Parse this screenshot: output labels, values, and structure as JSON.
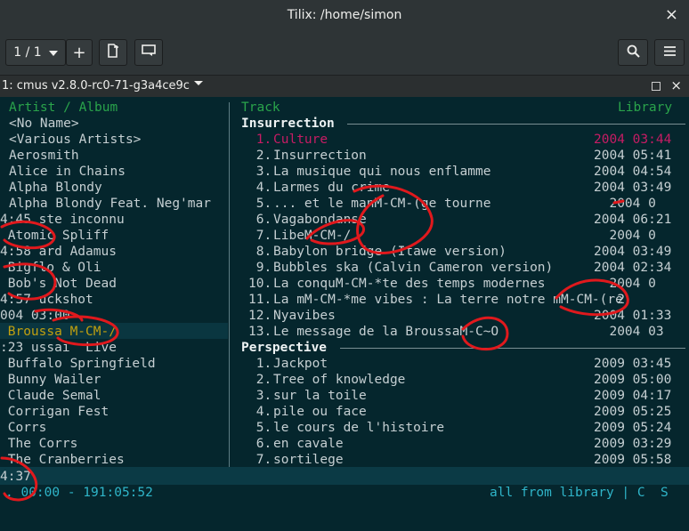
{
  "window": {
    "title": "Tilix: /home/simon",
    "close_glyph": "×"
  },
  "toolbar": {
    "session_count": "1 / 1",
    "add_label": "+",
    "icons": [
      "dropdown-icon",
      "plus-icon",
      "new-tab-icon",
      "sync-input-icon",
      "search-icon",
      "menu-icon"
    ]
  },
  "session": {
    "title": "1: cmus v2.8.0-rc0-71-g3a4ce9c"
  },
  "cmus": {
    "left_header": "Artist / Album",
    "track_header": "Track",
    "library_header": "Library",
    "artists": [
      {
        "text": "<No Name>"
      },
      {
        "text": "<Various Artists>"
      },
      {
        "text": "Aerosmith"
      },
      {
        "text": "Alice in Chains"
      },
      {
        "text": "Alpha Blondy"
      },
      {
        "text": "Alpha Blondy Feat. Neg'mar"
      },
      {
        "text": "4:45 ste inconnu"
      },
      {
        "text": " Atomic Spliff"
      },
      {
        "text": "4:58 ard Adamus"
      },
      {
        "text": " Bigflo & Oli"
      },
      {
        "text": " Bob's Not Dead"
      },
      {
        "text": "4:57 uckshot"
      },
      {
        "text": "004 03:00"
      },
      {
        "text": " Broussa M-CM-/"
      },
      {
        "text": ":23 ussai  Live"
      },
      {
        "text": " Buffalo Springfield"
      },
      {
        "text": " Bunny Wailer"
      },
      {
        "text": " Claude Semal"
      },
      {
        "text": " Corrigan Fest"
      },
      {
        "text": " Corrs"
      },
      {
        "text": " The Corrs"
      },
      {
        "text": " The Cranberries"
      }
    ],
    "albums": [
      {
        "title": "Insurrection",
        "tracks": [
          {
            "num": " 1.",
            "name": "Culture",
            "date": "2004 03:44",
            "active": true
          },
          {
            "num": " 2.",
            "name": "Insurrection",
            "date": "2004 05:41"
          },
          {
            "num": " 3.",
            "name": "La musique qui nous enflamme",
            "date": "2004 04:54"
          },
          {
            "num": " 4.",
            "name": "Larmes du crime",
            "date": "2004 03:49"
          },
          {
            "num": " 5.",
            "name": "... et le manM-CM-(ge tourne",
            "date": "  2004 0"
          },
          {
            "num": " 6.",
            "name": "Vagabondanse",
            "date": "2004 06:21"
          },
          {
            "num": " 7.",
            "name": "LibeM-CM-/",
            "date": "  2004 0"
          },
          {
            "num": " 8.",
            "name": "Babylon bridge (Itawe version)",
            "date": "2004 03:49"
          },
          {
            "num": " 9.",
            "name": "Bubbles ska (Calvin Cameron version)",
            "date": "2004 02:34"
          },
          {
            "num": "10.",
            "name": "La conquM-CM-*te des temps modernes",
            "date": "  2004 0"
          },
          {
            "num": "11.",
            "name": "La mM-CM-*me vibes : La terre notre mM-CM-(re",
            "date": "   2"
          },
          {
            "num": "12.",
            "name": "Nyavibes",
            "date": "2004 01:33"
          },
          {
            "num": "13.",
            "name": "Le message de la BroussaM-C~O",
            "date": "  2004 03"
          }
        ]
      },
      {
        "title": "Perspective",
        "tracks": [
          {
            "num": " 1.",
            "name": "Jackpot",
            "date": "2009 03:45"
          },
          {
            "num": " 2.",
            "name": "Tree of knowledge",
            "date": "2009 05:00"
          },
          {
            "num": " 3.",
            "name": "sur la toile",
            "date": "2009 04:17"
          },
          {
            "num": " 4.",
            "name": "pile ou face",
            "date": "2009 05:25"
          },
          {
            "num": " 5.",
            "name": "le cours de l'histoire",
            "date": "2009 05:24"
          },
          {
            "num": " 6.",
            "name": "en cavale",
            "date": "2009 03:29"
          },
          {
            "num": " 7.",
            "name": "sortilege",
            "date": "2009 05:58"
          }
        ]
      }
    ],
    "status_left": "4:37",
    "status_time": ". 00:00 - 191:05:52",
    "status_right": "all from library | C  S"
  },
  "colors": {
    "terminal_bg": "#05262d",
    "header": "#2aa44b",
    "active": "#c71c64",
    "selected": "#c1a00f",
    "status_bg": "#0b3a45",
    "status_text": "#2fb5c9",
    "annotation": "#e0191d"
  }
}
